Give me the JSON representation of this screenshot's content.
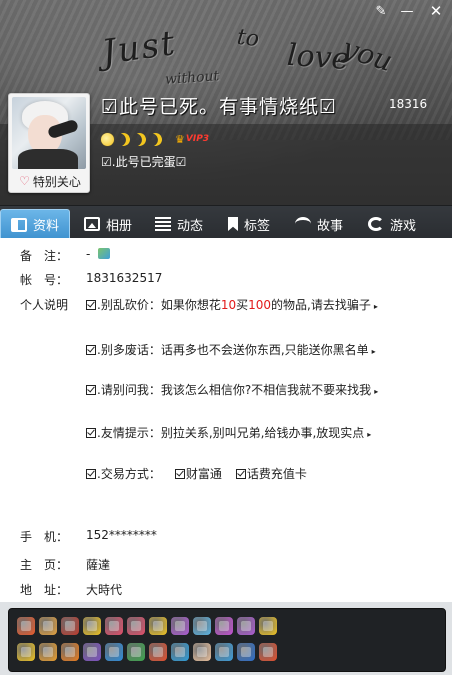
{
  "window": {
    "controls": {
      "skin_icon": "paintbrush-icon",
      "minimize_icon": "minimize-icon",
      "close_icon": "close-icon",
      "min_glyph": "—",
      "close_glyph": "✕",
      "skin_glyph": "✎"
    }
  },
  "banner": {
    "decor_words": [
      "Just",
      "to",
      "love",
      "you",
      "without"
    ]
  },
  "profile": {
    "nickname": "☑此号已死。有事情烧纸☑",
    "qq_number_short": "18316",
    "special_care_label": "特别关心",
    "level_icons": [
      "sun-icon",
      "moon-icon",
      "moon-icon",
      "moon-icon"
    ],
    "vip_label": "VIP3",
    "signature": "☑.此号已完蛋☑"
  },
  "tabs": [
    {
      "label": "资料",
      "icon": "profile-card-icon",
      "active": true
    },
    {
      "label": "相册",
      "icon": "photo-icon",
      "active": false
    },
    {
      "label": "动态",
      "icon": "feed-icon",
      "active": false
    },
    {
      "label": "标签",
      "icon": "tag-icon",
      "active": false
    },
    {
      "label": "故事",
      "icon": "story-icon",
      "active": false
    },
    {
      "label": "游戏",
      "icon": "game-icon",
      "active": false
    }
  ],
  "info": {
    "remark_label": "备　注：",
    "remark_value": "-",
    "account_label": "帐　号：",
    "account_value": "1831632517",
    "bio_label": "个人说明",
    "bio_lines": [
      {
        "prefix": ".别乱砍价：如果你想花",
        "num1": "10",
        "mid": "买",
        "num2": "100",
        "suffix": "的物品,请去找骗子"
      },
      {
        "text": ".别多废话：话再多也不会送你东西,只能送你黑名单"
      },
      {
        "text": ".请别问我：我该怎么相信你?不相信我就不要来找我"
      },
      {
        "text": ".友情提示：别拉关系,别叫兄弟,给钱办事,放现实点"
      },
      {
        "trade_label": ".交易方式：",
        "option1": "财富通",
        "option2": "话费充值卡"
      }
    ],
    "phone_label": "手　机：",
    "phone_value": "152********",
    "homepage_label": "主　页：",
    "homepage_value": "薩達",
    "address_label": "地　址：",
    "address_value": "大時代"
  },
  "badges": {
    "row1": [
      "#f05a28",
      "#e8a33d",
      "#c0392b",
      "#f3c61f",
      "#e84d6a",
      "#e84d6a",
      "#f3c61f",
      "#b05ad8",
      "#5ab7e8",
      "#c94fd8",
      "#b05ad8",
      "#f3c61f"
    ],
    "row2": [
      "#f3c61f",
      "#f0a02a",
      "#f07d1a",
      "#7f4fc9",
      "#2a8ee0",
      "#3aa84b",
      "#e84d2a",
      "#2aa0e0",
      "#f0c5a0",
      "#3aa0e0",
      "#2a6fd0",
      "#e84d2a"
    ]
  }
}
